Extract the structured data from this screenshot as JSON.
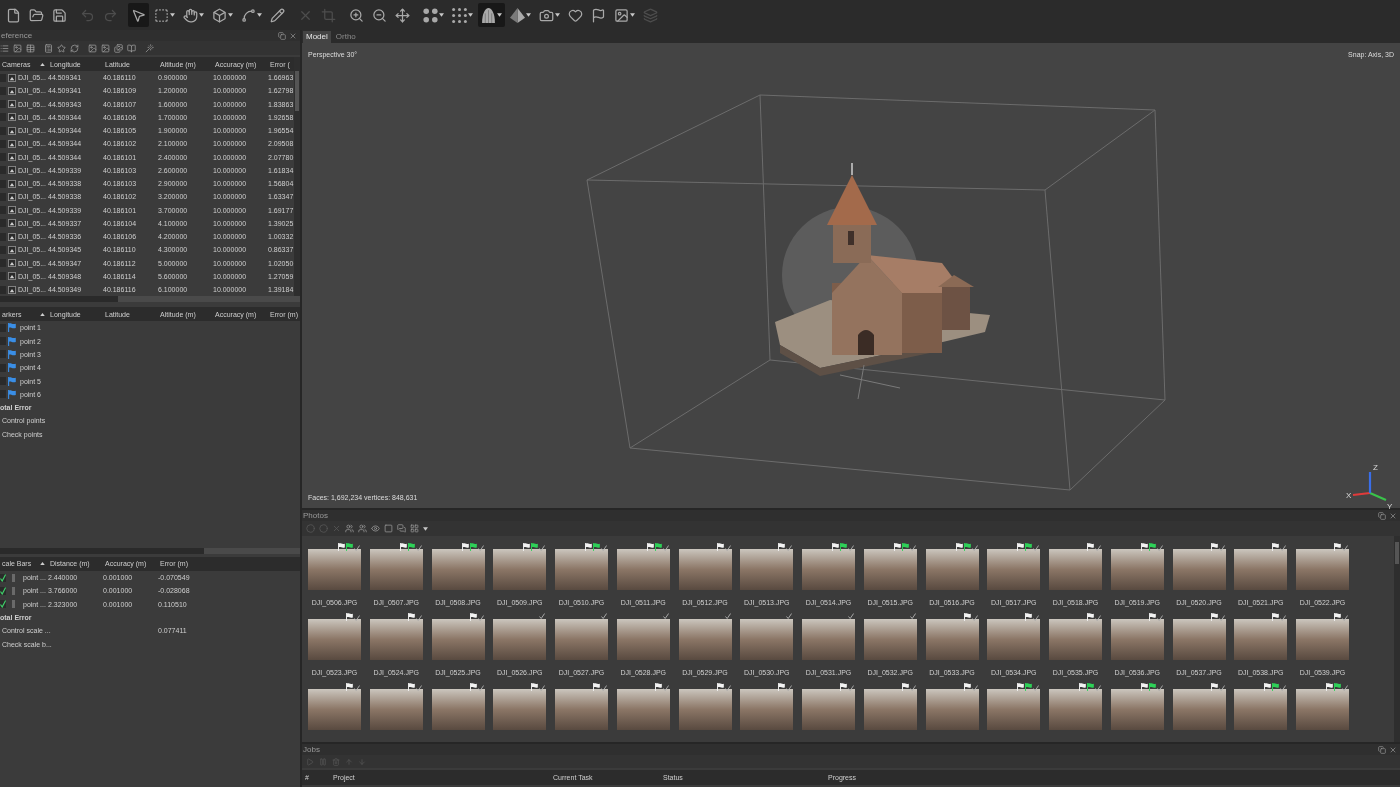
{
  "toolbar": {
    "tools": [
      {
        "selected": false,
        "disabled": false
      },
      {
        "selected": false,
        "disabled": false
      },
      {
        "selected": false,
        "disabled": false
      },
      {
        "selected": false,
        "disabled": true
      },
      {
        "selected": false,
        "disabled": true
      },
      {
        "selected": true,
        "disabled": false
      },
      {
        "selected": false,
        "disabled": false
      },
      {
        "selected": false,
        "disabled": false
      },
      {
        "selected": false,
        "disabled": false
      },
      {
        "selected": false,
        "disabled": false
      },
      {
        "selected": false,
        "disabled": false
      },
      {
        "selected": false,
        "disabled": true
      },
      {
        "selected": false,
        "disabled": true
      },
      {
        "selected": false,
        "disabled": false
      },
      {
        "selected": false,
        "disabled": false
      },
      {
        "selected": false,
        "disabled": false
      },
      {
        "selected": false,
        "disabled": false
      },
      {
        "selected": false,
        "disabled": false
      },
      {
        "selected": true,
        "disabled": false
      },
      {
        "selected": false,
        "disabled": false
      },
      {
        "selected": false,
        "disabled": false
      },
      {
        "selected": false,
        "disabled": false
      },
      {
        "selected": false,
        "disabled": false
      },
      {
        "selected": false,
        "disabled": false
      },
      {
        "selected": false,
        "disabled": true
      }
    ]
  },
  "reference": {
    "title": "eference",
    "cameras": {
      "columns": [
        "Cameras",
        "Longitude",
        "Latitude",
        "Altitude (m)",
        "Accuracy (m)",
        "Error ("
      ],
      "rows": [
        {
          "checked": false,
          "cells": [
            "DJI_05...",
            "44.509341",
            "40.186110",
            "0.900000",
            "10.000000",
            "1.66963"
          ]
        },
        {
          "checked": false,
          "cells": [
            "DJI_05...",
            "44.509341",
            "40.186109",
            "1.200000",
            "10.000000",
            "1.62798"
          ]
        },
        {
          "checked": false,
          "cells": [
            "DJI_05...",
            "44.509343",
            "40.186107",
            "1.600000",
            "10.000000",
            "1.83863"
          ]
        },
        {
          "checked": false,
          "cells": [
            "DJI_05...",
            "44.509344",
            "40.186106",
            "1.700000",
            "10.000000",
            "1.92658"
          ]
        },
        {
          "checked": false,
          "cells": [
            "DJI_05...",
            "44.509344",
            "40.186105",
            "1.900000",
            "10.000000",
            "1.96554"
          ]
        },
        {
          "checked": false,
          "cells": [
            "DJI_05...",
            "44.509344",
            "40.186102",
            "2.100000",
            "10.000000",
            "2.09508"
          ]
        },
        {
          "checked": false,
          "cells": [
            "DJI_05...",
            "44.509344",
            "40.186101",
            "2.400000",
            "10.000000",
            "2.07780"
          ]
        },
        {
          "checked": false,
          "cells": [
            "DJI_05...",
            "44.509339",
            "40.186103",
            "2.600000",
            "10.000000",
            "1.61834"
          ]
        },
        {
          "checked": false,
          "cells": [
            "DJI_05...",
            "44.509338",
            "40.186103",
            "2.900000",
            "10.000000",
            "1.56804"
          ]
        },
        {
          "checked": false,
          "cells": [
            "DJI_05...",
            "44.509338",
            "40.186102",
            "3.200000",
            "10.000000",
            "1.63347"
          ]
        },
        {
          "checked": false,
          "cells": [
            "DJI_05...",
            "44.509339",
            "40.186101",
            "3.700000",
            "10.000000",
            "1.69177"
          ]
        },
        {
          "checked": false,
          "cells": [
            "DJI_05...",
            "44.509337",
            "40.186104",
            "4.100000",
            "10.000000",
            "1.39025"
          ]
        },
        {
          "checked": false,
          "cells": [
            "DJI_05...",
            "44.509336",
            "40.186106",
            "4.200000",
            "10.000000",
            "1.00332"
          ]
        },
        {
          "checked": false,
          "cells": [
            "DJI_05...",
            "44.509345",
            "40.186110",
            "4.300000",
            "10.000000",
            "0.86337"
          ]
        },
        {
          "checked": false,
          "cells": [
            "DJI_05...",
            "44.509347",
            "40.186112",
            "5.000000",
            "10.000000",
            "1.02050"
          ]
        },
        {
          "checked": false,
          "cells": [
            "DJI_05...",
            "44.509348",
            "40.186114",
            "5.600000",
            "10.000000",
            "1.27059"
          ]
        },
        {
          "checked": false,
          "cells": [
            "DJI_05...",
            "44.509349",
            "40.186116",
            "6.100000",
            "10.000000",
            "1.39184"
          ]
        }
      ]
    },
    "markers": {
      "columns": [
        "arkers",
        "Longitude",
        "Latitude",
        "Altitude (m)",
        "Accuracy (m)",
        "Error (m)"
      ],
      "rows": [
        {
          "name": "point 1",
          "checked": false
        },
        {
          "name": "point 2",
          "checked": false
        },
        {
          "name": "point 3",
          "checked": false
        },
        {
          "name": "point 4",
          "checked": false
        },
        {
          "name": "point 5",
          "checked": false
        },
        {
          "name": "point 6",
          "checked": false
        }
      ],
      "total": {
        "label": "otal Error",
        "rows": [
          {
            "name": "Control points"
          },
          {
            "name": "Check points"
          }
        ]
      }
    },
    "scale_bars": {
      "columns": [
        "cale Bars",
        "Distance (m)",
        "Accuracy (m)",
        "Error (m)"
      ],
      "rows": [
        {
          "checked": true,
          "cells": [
            "point ...",
            "2.440000",
            "0.001000",
            "-0.070549"
          ]
        },
        {
          "checked": true,
          "cells": [
            "point ...",
            "3.766000",
            "0.001000",
            "-0.028068"
          ]
        },
        {
          "checked": true,
          "cells": [
            "point ...",
            "2.323000",
            "0.001000",
            "0.110510"
          ]
        }
      ],
      "total": {
        "label": "otal Error",
        "rows": [
          {
            "name": "Control scale ...",
            "error": "0.077411"
          },
          {
            "name": "Check scale b..."
          }
        ]
      }
    }
  },
  "viewport": {
    "tabs": [
      {
        "label": "Model",
        "selected": true
      },
      {
        "label": "Ortho",
        "selected": false
      }
    ],
    "projection": "Perspective 30°",
    "snap": "Snap: Axis, 3D",
    "stats": "Faces: 1,692,234 vertices: 848,631",
    "axes": [
      {
        "label": "X",
        "color": "#e03a3a"
      },
      {
        "label": "Y",
        "color": "#3ac24a"
      },
      {
        "label": "Z",
        "color": "#3a6ee8"
      }
    ]
  },
  "photos": {
    "title": "Photos",
    "items": [
      {
        "label": "DJI_0506.JPG",
        "marker": true,
        "pinned": true,
        "aligned": true
      },
      {
        "label": "DJI_0507.JPG",
        "marker": true,
        "pinned": true,
        "aligned": true
      },
      {
        "label": "DJI_0508.JPG",
        "marker": true,
        "pinned": true,
        "aligned": true
      },
      {
        "label": "DJI_0509.JPG",
        "marker": true,
        "pinned": true,
        "aligned": true
      },
      {
        "label": "DJI_0510.JPG",
        "marker": true,
        "pinned": true,
        "aligned": true
      },
      {
        "label": "DJI_0511.JPG",
        "marker": true,
        "pinned": true,
        "aligned": true
      },
      {
        "label": "DJI_0512.JPG",
        "marker": true,
        "pinned": false,
        "aligned": true
      },
      {
        "label": "DJI_0513.JPG",
        "marker": true,
        "pinned": false,
        "aligned": true
      },
      {
        "label": "DJI_0514.JPG",
        "marker": true,
        "pinned": true,
        "aligned": true
      },
      {
        "label": "DJI_0515.JPG",
        "marker": true,
        "pinned": true,
        "aligned": true
      },
      {
        "label": "DJI_0516.JPG",
        "marker": true,
        "pinned": true,
        "aligned": true
      },
      {
        "label": "DJI_0517.JPG",
        "marker": true,
        "pinned": true,
        "aligned": true
      },
      {
        "label": "DJI_0518.JPG",
        "marker": true,
        "pinned": false,
        "aligned": true
      },
      {
        "label": "DJI_0519.JPG",
        "marker": true,
        "pinned": true,
        "aligned": true
      },
      {
        "label": "DJI_0520.JPG",
        "marker": true,
        "pinned": false,
        "aligned": true
      },
      {
        "label": "DJI_0521.JPG",
        "marker": true,
        "pinned": false,
        "aligned": true
      },
      {
        "label": "DJI_0522.JPG",
        "marker": true,
        "pinned": false,
        "aligned": true
      },
      {
        "label": "DJI_0523.JPG",
        "marker": true,
        "pinned": false,
        "aligned": true
      },
      {
        "label": "DJI_0524.JPG",
        "marker": true,
        "pinned": false,
        "aligned": true
      },
      {
        "label": "DJI_0525.JPG",
        "marker": true,
        "pinned": false,
        "aligned": true
      },
      {
        "label": "DJI_0526.JPG",
        "marker": false,
        "pinned": false,
        "aligned": true
      },
      {
        "label": "DJI_0527.JPG",
        "marker": false,
        "pinned": false,
        "aligned": true
      },
      {
        "label": "DJI_0528.JPG",
        "marker": false,
        "pinned": false,
        "aligned": true
      },
      {
        "label": "DJI_0529.JPG",
        "marker": false,
        "pinned": false,
        "aligned": true
      },
      {
        "label": "DJI_0530.JPG",
        "marker": false,
        "pinned": false,
        "aligned": true
      },
      {
        "label": "DJI_0531.JPG",
        "marker": false,
        "pinned": false,
        "aligned": true
      },
      {
        "label": "DJI_0532.JPG",
        "marker": false,
        "pinned": false,
        "aligned": true
      },
      {
        "label": "DJI_0533.JPG",
        "marker": true,
        "pinned": false,
        "aligned": true
      },
      {
        "label": "DJI_0534.JPG",
        "marker": true,
        "pinned": false,
        "aligned": true
      },
      {
        "label": "DJI_0535.JPG",
        "marker": true,
        "pinned": false,
        "aligned": true
      },
      {
        "label": "DJI_0536.JPG",
        "marker": true,
        "pinned": false,
        "aligned": true
      },
      {
        "label": "DJI_0537.JPG",
        "marker": true,
        "pinned": false,
        "aligned": true
      },
      {
        "label": "DJI_0538.JPG",
        "marker": true,
        "pinned": false,
        "aligned": true
      },
      {
        "label": "DJI_0539.JPG",
        "marker": true,
        "pinned": false,
        "aligned": true
      },
      {
        "marker": true,
        "pinned": false,
        "aligned": true
      },
      {
        "marker": true,
        "pinned": false,
        "aligned": true
      },
      {
        "marker": true,
        "pinned": false,
        "aligned": true
      },
      {
        "marker": true,
        "pinned": false,
        "aligned": true
      },
      {
        "marker": true,
        "pinned": false,
        "aligned": true
      },
      {
        "marker": true,
        "pinned": false,
        "aligned": true
      },
      {
        "marker": true,
        "pinned": false,
        "aligned": true
      },
      {
        "marker": true,
        "pinned": false,
        "aligned": true
      },
      {
        "marker": true,
        "pinned": false,
        "aligned": true
      },
      {
        "marker": true,
        "pinned": false,
        "aligned": true
      },
      {
        "marker": true,
        "pinned": false,
        "aligned": true
      },
      {
        "marker": true,
        "pinned": true,
        "aligned": true
      },
      {
        "marker": true,
        "pinned": true,
        "aligned": true
      },
      {
        "marker": true,
        "pinned": true,
        "aligned": true
      },
      {
        "marker": true,
        "pinned": false,
        "aligned": true
      },
      {
        "marker": true,
        "pinned": true,
        "aligned": true
      },
      {
        "marker": true,
        "pinned": true,
        "aligned": true
      }
    ]
  },
  "jobs": {
    "title": "Jobs",
    "columns": [
      "#",
      "Project",
      "Current Task",
      "Status",
      "Progress"
    ]
  }
}
